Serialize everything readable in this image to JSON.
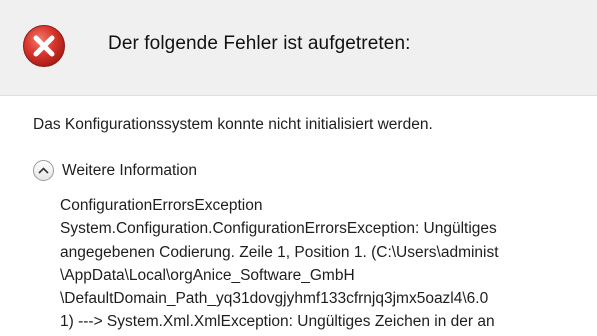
{
  "header": {
    "icon": "error-icon",
    "title": "Der folgende Fehler ist aufgetreten:",
    "colors": {
      "background": "#f0f0f0",
      "icon_red": "#d9362c"
    }
  },
  "main": {
    "message": "Das Konfigurationssystem konnte nicht initialisiert werden."
  },
  "expander": {
    "icon": "chevron-up-icon",
    "label": "Weitere Information",
    "expanded": true
  },
  "details": {
    "lines": [
      "ConfigurationErrorsException",
      "System.Configuration.ConfigurationErrorsException: Ungültiges",
      "angegebenen Codierung. Zeile 1, Position 1. (C:\\Users\\administ",
      "\\AppData\\Local\\orgAnice_Software_GmbH",
      "\\DefaultDomain_Path_yq31dovgjyhmf133cfrnjq3jmx5oazl4\\6.0",
      "1) ---> System.Xml.XmlException: Ungültiges Zeichen in der an"
    ]
  }
}
